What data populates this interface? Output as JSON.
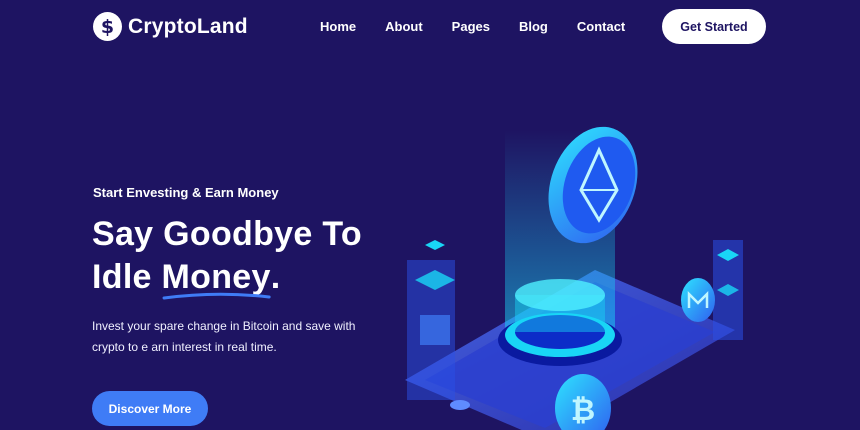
{
  "header": {
    "logo_text": "CryptoLand",
    "logo_glyph": "$",
    "nav": [
      "Home",
      "About",
      "Pages",
      "Blog",
      "Contact"
    ],
    "cta_label": "Get Started"
  },
  "hero": {
    "eyebrow": "Start Envesting & Earn Money",
    "headline_line1": "Say Goodbye To",
    "headline_line2_a": "Idle ",
    "headline_line2_underlined": "Money",
    "headline_line2_b": ".",
    "description": "Invest your spare change in Bitcoin and save with crypto to e arn interest in real time.",
    "button_label": "Discover More"
  },
  "theme": {
    "background": "#1e1462",
    "accent": "#3f7cf6",
    "illustration_cyan": "#19d6f6",
    "illustration_blue": "#2f5ef0"
  },
  "icons": [
    "dollar-coin-icon",
    "ethereum-coin-icon",
    "bitcoin-coin-icon",
    "monero-coin-icon"
  ]
}
